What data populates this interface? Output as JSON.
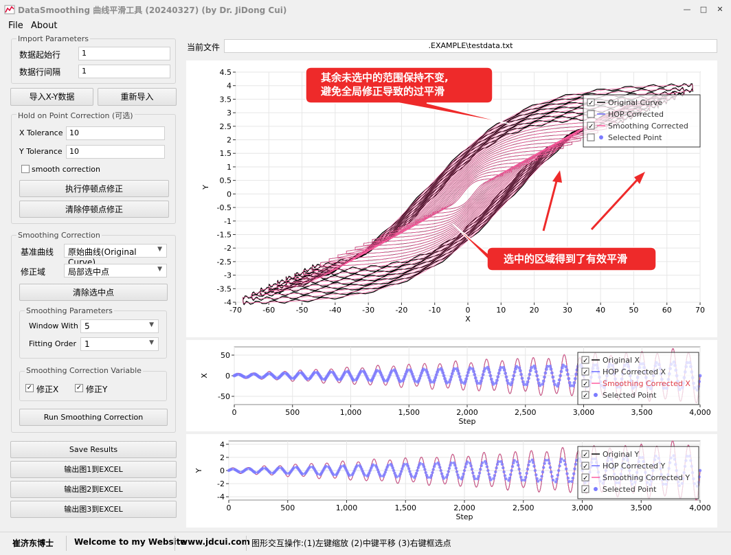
{
  "window": {
    "title": "DataSmoothing 曲线平滑工具 (20240327) (by Dr. JiDong Cui)",
    "min": "—",
    "max": "□",
    "close": "✕"
  },
  "menu": [
    "File",
    "About"
  ],
  "import": {
    "legend": "Import Parameters",
    "start_row_label": "数据起始行",
    "start_row": "1",
    "interval_label": "数据行间隔",
    "interval": "1",
    "import_btn": "导入X-Y数据",
    "reimport_btn": "重新导入"
  },
  "hop": {
    "legend": "Hold on Point Correction (可选)",
    "xtol_label": "X Tolerance",
    "xtol": "10",
    "ytol_label": "Y Tolerance",
    "ytol": "10",
    "smooth_label": "smooth correction",
    "run_btn": "执行停顿点修正",
    "clear_btn": "清除停顿点修正"
  },
  "smooth": {
    "legend": "Smoothing Correction",
    "base_label": "基准曲线",
    "base_value": "原始曲线(Original Curve)",
    "domain_label": "修正域",
    "domain_value": "局部选中点",
    "clear_btn": "清除选中点",
    "params_legend": "Smoothing Parameters",
    "window_label": "Window With",
    "window_value": "5",
    "order_label": "Fitting Order",
    "order_value": "1",
    "var_legend": "Smoothing Correction Variable",
    "fix_x": "修正X",
    "fix_y": "修正Y",
    "run_btn": "Run Smoothing Correction"
  },
  "save_btn": "Save Results",
  "export1": "输出图1到EXCEL",
  "export2": "输出图2到EXCEL",
  "export3": "输出图3到EXCEL",
  "file": {
    "label": "当前文件",
    "path": ".EXAMPLE\\testdata.txt"
  },
  "annotation_top": "其余未选中的范围保持不变,\n避免全局修正导致的过平滑",
  "annotation_bottom": "选中的区域得到了有效平滑",
  "status": {
    "name": "崔济东博士",
    "welcome": "Welcome to my Website",
    "site": "www.jdcui.com",
    "hint": "图形交互操作:(1)左键缩放 (2)中键平移 (3)右键框选点"
  },
  "colors": {
    "original": "#000000",
    "hop": "#6a6aff",
    "smooth": "#ff5ca0",
    "selected": "#7b7bff",
    "callout": "#ee2a2a"
  },
  "chart_data": [
    {
      "type": "line",
      "title": "",
      "xlabel": "X",
      "ylabel": "Y",
      "xlim": [
        -70,
        70
      ],
      "ylim": [
        -4,
        4.5
      ],
      "xticks": [
        -70,
        -60,
        -50,
        -40,
        -30,
        -20,
        -10,
        0,
        10,
        20,
        30,
        40,
        50,
        60,
        70
      ],
      "yticks": [
        -4,
        -3.5,
        -3,
        -2.5,
        -2,
        -1.5,
        -1,
        -0.5,
        0,
        0.5,
        1,
        1.5,
        2,
        2.5,
        3,
        3.5,
        4,
        4.5
      ],
      "legend": [
        "Original Curve",
        "HOP Corrected",
        "Smoothing Corrected",
        "Selected Point"
      ],
      "legend_checked": [
        true,
        false,
        true,
        false
      ],
      "legend_position": "top-right"
    },
    {
      "type": "line",
      "title": "",
      "xlabel": "Step",
      "ylabel": "X",
      "xlim": [
        0,
        4000
      ],
      "ylim": [
        -70,
        70
      ],
      "xticks": [
        0,
        500,
        1000,
        1500,
        2000,
        2500,
        3000,
        3500,
        4000
      ],
      "xtick_labels": [
        "0",
        "500",
        "1,000",
        "1,500",
        "2,000",
        "2,500",
        "3,000",
        "3,500",
        "4,000"
      ],
      "yticks": [
        -50,
        0,
        50
      ],
      "legend": [
        "Original X",
        "HOP Corrected X",
        "Smoothing Corrected X",
        "Selected Point"
      ],
      "legend_checked": [
        true,
        true,
        true,
        true
      ],
      "legend_position": "top-right"
    },
    {
      "type": "line",
      "title": "",
      "xlabel": "Step",
      "ylabel": "Y",
      "xlim": [
        0,
        4000
      ],
      "ylim": [
        -4.5,
        4.5
      ],
      "xticks": [
        0,
        500,
        1000,
        1500,
        2000,
        2500,
        3000,
        3500,
        4000
      ],
      "xtick_labels": [
        "0",
        "500",
        "1,000",
        "1,500",
        "2,000",
        "2,500",
        "3,000",
        "3,500",
        "4,000"
      ],
      "yticks": [
        -4,
        -2,
        0,
        2,
        4
      ],
      "legend": [
        "Original Y",
        "HOP Corrected Y",
        "Smoothing Corrected Y",
        "Selected Point"
      ],
      "legend_checked": [
        true,
        true,
        true,
        true
      ],
      "legend_position": "top-right"
    }
  ]
}
